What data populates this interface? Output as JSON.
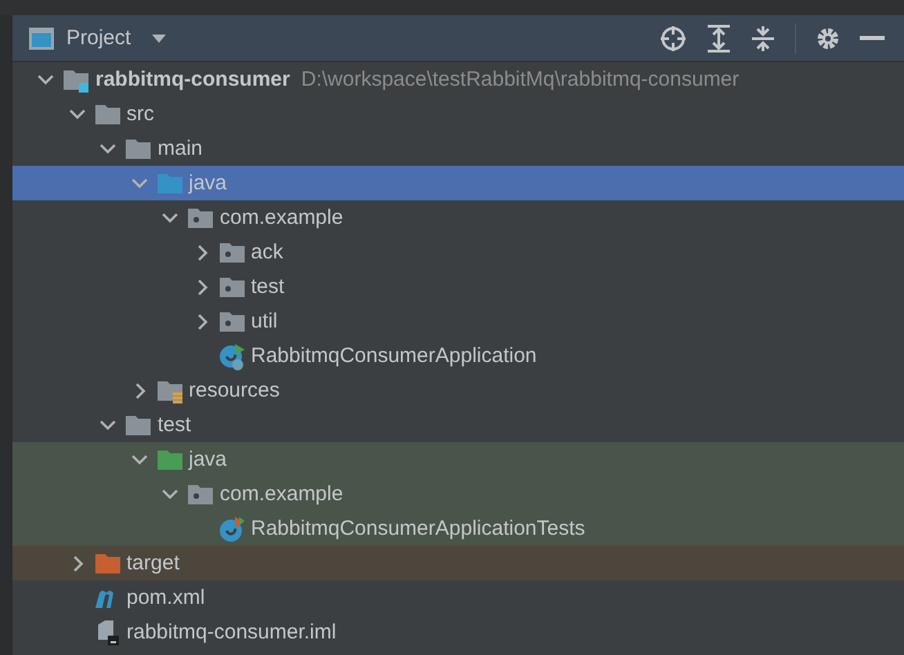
{
  "panel": {
    "title": "Project"
  },
  "tree": [
    {
      "name": "rabbitmq-consumer",
      "path": "D:\\workspace\\testRabbitMq\\rabbitmq-consumer",
      "kind": "module",
      "expanded": true,
      "selected": false,
      "children": [
        {
          "name": "src",
          "kind": "folder",
          "expanded": true,
          "selected": false,
          "children": [
            {
              "name": "main",
              "kind": "folder",
              "expanded": true,
              "selected": false,
              "children": [
                {
                  "name": "java",
                  "kind": "source-root",
                  "expanded": true,
                  "selected": true,
                  "children": [
                    {
                      "name": "com.example",
                      "kind": "package",
                      "expanded": true,
                      "selected": false,
                      "children": [
                        {
                          "name": "ack",
                          "kind": "package",
                          "expanded": false,
                          "selected": false
                        },
                        {
                          "name": "test",
                          "kind": "package",
                          "expanded": false,
                          "selected": false
                        },
                        {
                          "name": "util",
                          "kind": "package",
                          "expanded": false,
                          "selected": false
                        },
                        {
                          "name": "RabbitmqConsumerApplication",
                          "kind": "spring-class",
                          "selected": false
                        }
                      ]
                    }
                  ]
                },
                {
                  "name": "resources",
                  "kind": "resources-root",
                  "expanded": false,
                  "selected": false
                }
              ]
            },
            {
              "name": "test",
              "kind": "folder",
              "expanded": true,
              "selected": false,
              "children": [
                {
                  "name": "java",
                  "kind": "test-root",
                  "expanded": true,
                  "selected": false,
                  "children": [
                    {
                      "name": "com.example",
                      "kind": "package",
                      "expanded": true,
                      "selected": false,
                      "children": [
                        {
                          "name": "RabbitmqConsumerApplicationTests",
                          "kind": "test-class",
                          "selected": false
                        }
                      ]
                    }
                  ]
                }
              ]
            }
          ]
        },
        {
          "name": "target",
          "kind": "excluded",
          "expanded": false,
          "selected": false
        },
        {
          "name": "pom.xml",
          "kind": "maven",
          "selected": false
        },
        {
          "name": "rabbitmq-consumer.iml",
          "kind": "iml",
          "selected": false
        }
      ]
    }
  ]
}
